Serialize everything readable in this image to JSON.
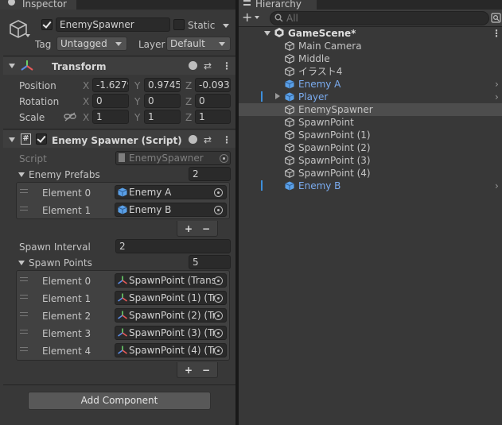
{
  "inspector": {
    "tab_label": "Inspector",
    "object": {
      "name": "EnemySpawner",
      "active": true,
      "static_label": "Static",
      "tag_label": "Tag",
      "tag_value": "Untagged",
      "layer_label": "Layer",
      "layer_value": "Default"
    },
    "transform": {
      "title": "Transform",
      "position_label": "Position",
      "rotation_label": "Rotation",
      "scale_label": "Scale",
      "axis_x": "X",
      "axis_y": "Y",
      "axis_z": "Z",
      "position": {
        "x": "-1.6279",
        "y": "0.9745",
        "z": "-0.093"
      },
      "rotation": {
        "x": "0",
        "y": "0",
        "z": "0"
      },
      "scale": {
        "x": "1",
        "y": "1",
        "z": "1"
      }
    },
    "script_component": {
      "title": "Enemy Spawner (Script)",
      "enabled": true,
      "script_label": "Script",
      "script_value": "EnemySpawner",
      "enemy_prefabs_label": "Enemy Prefabs",
      "enemy_prefabs_size": "2",
      "enemy_prefabs": [
        {
          "label": "Element 0",
          "value": "Enemy A"
        },
        {
          "label": "Element 1",
          "value": "Enemy B"
        }
      ],
      "spawn_interval_label": "Spawn Interval",
      "spawn_interval_value": "2",
      "spawn_points_label": "Spawn Points",
      "spawn_points_size": "5",
      "spawn_points": [
        {
          "label": "Element 0",
          "value": "SpawnPoint (Trans"
        },
        {
          "label": "Element 1",
          "value": "SpawnPoint (1) (Tr"
        },
        {
          "label": "Element 2",
          "value": "SpawnPoint (2) (Tr"
        },
        {
          "label": "Element 3",
          "value": "SpawnPoint (3) (Tr"
        },
        {
          "label": "Element 4",
          "value": "SpawnPoint (4) (Tr"
        }
      ],
      "add_label": "+",
      "remove_label": "−"
    },
    "add_component_label": "Add Component"
  },
  "hierarchy": {
    "tab_label": "Hierarchy",
    "add_label": "+",
    "search_placeholder": "All",
    "scene_name": "GameScene*",
    "items": [
      {
        "label": "Main Camera",
        "prefab": false
      },
      {
        "label": "Middle",
        "prefab": false
      },
      {
        "label": "イラスト4",
        "prefab": false
      },
      {
        "label": "Enemy A",
        "prefab": true
      },
      {
        "label": "Player",
        "prefab": true
      },
      {
        "label": "EnemySpawner",
        "prefab": false
      },
      {
        "label": "SpawnPoint",
        "prefab": false
      },
      {
        "label": "SpawnPoint (1)",
        "prefab": false
      },
      {
        "label": "SpawnPoint (2)",
        "prefab": false
      },
      {
        "label": "SpawnPoint (3)",
        "prefab": false
      },
      {
        "label": "SpawnPoint (4)",
        "prefab": false
      },
      {
        "label": "Enemy B",
        "prefab": true
      }
    ]
  },
  "colors": {
    "panel_bg": "#383838",
    "tab_bar_bg": "#282828",
    "prefab_blue": "#7bacf0",
    "selected_row": "#4d4d4d",
    "modified_marker": "#3d8fdb"
  }
}
